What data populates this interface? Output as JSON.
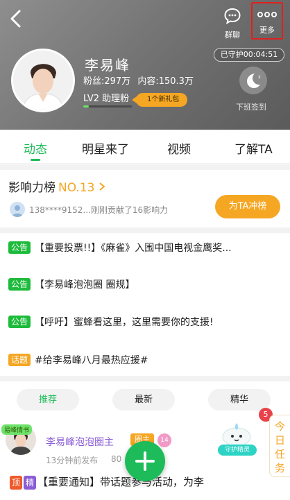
{
  "header": {
    "group_label": "群聊",
    "more_label": "更多",
    "guard_time": "已守护00:04:51",
    "checkin_label": "下班签到",
    "star_name": "李易峰",
    "fans_label": "粉丝:297万",
    "content_label": "内容:150.3万",
    "level_label": "LV2 助理粉",
    "gift_label": "1个新礼包"
  },
  "tabs": [
    "动态",
    "明星来了",
    "视频",
    "了解TA"
  ],
  "influence": {
    "title": "影响力榜",
    "rank": "NO.13",
    "donor_text": "138****9152...刚刚贡献了16影响力",
    "button": "为TA冲榜"
  },
  "notices": [
    {
      "badge": "公告",
      "badge_color": "#1dbb3b",
      "text": "【重要投票!!】《麻雀》入围中国电视金鹰奖..."
    },
    {
      "badge": "公告",
      "badge_color": "#1dbb3b",
      "text": "【李易峰泡泡圈 圈规】"
    },
    {
      "badge": "公告",
      "badge_color": "#1dbb3b",
      "text": "【呼吁】蜜蜂看这里，这里需要你的支援!"
    },
    {
      "badge": "话题",
      "badge_color": "#f5a623",
      "text": "#给李易峰八月最热应援#"
    }
  ],
  "filters": [
    "推荐",
    "最新",
    "精华"
  ],
  "post": {
    "tag": "易峰情书",
    "author": "李易峰泡泡圈主",
    "author_badge": "圈主",
    "level": "14",
    "time": "13分钟前发布",
    "count": "80",
    "pill_top": "顶",
    "pill_elite": "精",
    "body": "【重要通知】带话题参与活动，为李"
  },
  "guardian_label": "守护精灵",
  "task": {
    "count": "5",
    "label": "今日任务"
  },
  "colors": {
    "accent": "#1dbb59",
    "orange": "#f5a623",
    "highlight_box": "#e0201f"
  }
}
